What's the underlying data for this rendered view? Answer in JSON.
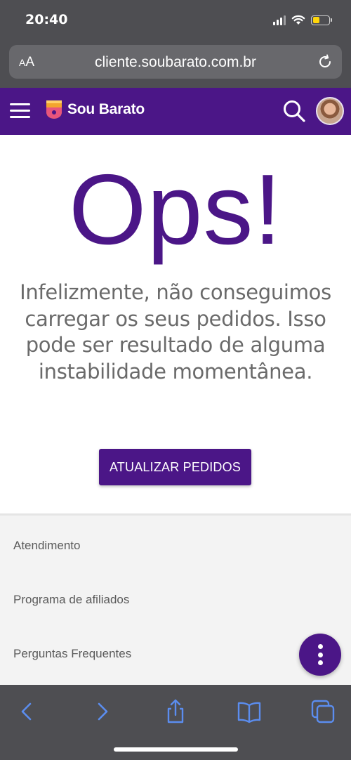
{
  "status_bar": {
    "time": "20:40"
  },
  "browser": {
    "text_size_button": "AA",
    "url": "cliente.soubarato.com.br"
  },
  "header": {
    "brand_name": "Sou Barato",
    "brand_color": "#4b1687"
  },
  "main": {
    "title": "Ops!",
    "message": "Infelizmente, não conseguimos carregar os seus pedidos. Isso pode ser resultado de alguma instabilidade momentânea.",
    "refresh_button": "ATUALIZAR PEDIDOS"
  },
  "footer": {
    "links": [
      {
        "label": "Atendimento"
      },
      {
        "label": "Programa de afiliados"
      },
      {
        "label": "Perguntas Frequentes"
      }
    ]
  },
  "toolbar": {
    "icons": [
      "back-icon",
      "forward-icon",
      "share-icon",
      "bookmarks-icon",
      "tabs-icon"
    ]
  },
  "colors": {
    "accent": "#4b1687",
    "toolbar_icon": "#5b8def",
    "browser_chrome": "#4e4e52"
  }
}
